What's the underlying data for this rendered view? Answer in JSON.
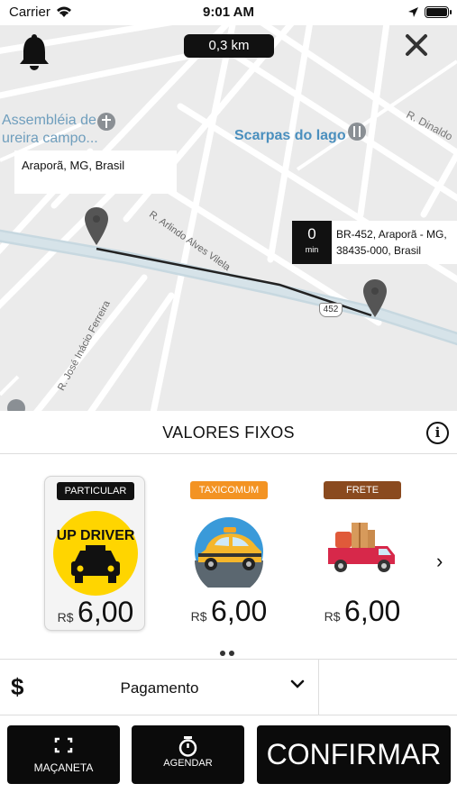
{
  "status_bar": {
    "carrier": "Carrier",
    "time": "9:01 AM"
  },
  "map": {
    "distance": "0,3 km",
    "labels": {
      "assembleia_line1": "Assembléia de",
      "assembleia_line2": "ureira campo...",
      "scarpas": "Scarpas do lago",
      "dinaldo": "R. Dinaldo",
      "arlindo": "R. Arlindo Alves Vilela",
      "jose": "R. José Inácio Ferreira",
      "route_shield": "452"
    },
    "origin_address": "Araporã, MG, Brasil",
    "destination": {
      "eta_value": "0",
      "eta_unit": "min",
      "address": "BR-452, Araporã - MG, 38435-000, Brasil"
    }
  },
  "panel": {
    "title": "VALORES FIXOS",
    "info_icon": "i",
    "next_icon": "›",
    "categories": [
      {
        "badge": "PARTICULAR",
        "badge_color": "#111111",
        "brand_text": "UP DRIVER",
        "currency": "R$",
        "price": "6,00",
        "selected": true
      },
      {
        "badge": "TAXICOMUM",
        "badge_color": "#f39323",
        "currency": "R$",
        "price": "6,00",
        "selected": false
      },
      {
        "badge": "FRETE",
        "badge_color": "#8a4a1f",
        "currency": "R$",
        "price": "6,00",
        "selected": false
      }
    ]
  },
  "payment": {
    "icon": "$",
    "label": "Pagamento"
  },
  "buttons": {
    "macaneta": "MAÇANETA",
    "agendar": "AGENDAR",
    "confirmar": "CONFIRMAR"
  },
  "colors": {
    "map_bg": "#ebebeb",
    "road": "#ffffff",
    "highway": "#cfdde4",
    "route_line": "#222222",
    "pin": "#555555",
    "accent_yellow": "#ffd500",
    "dark_button": "#0b0b0b"
  }
}
